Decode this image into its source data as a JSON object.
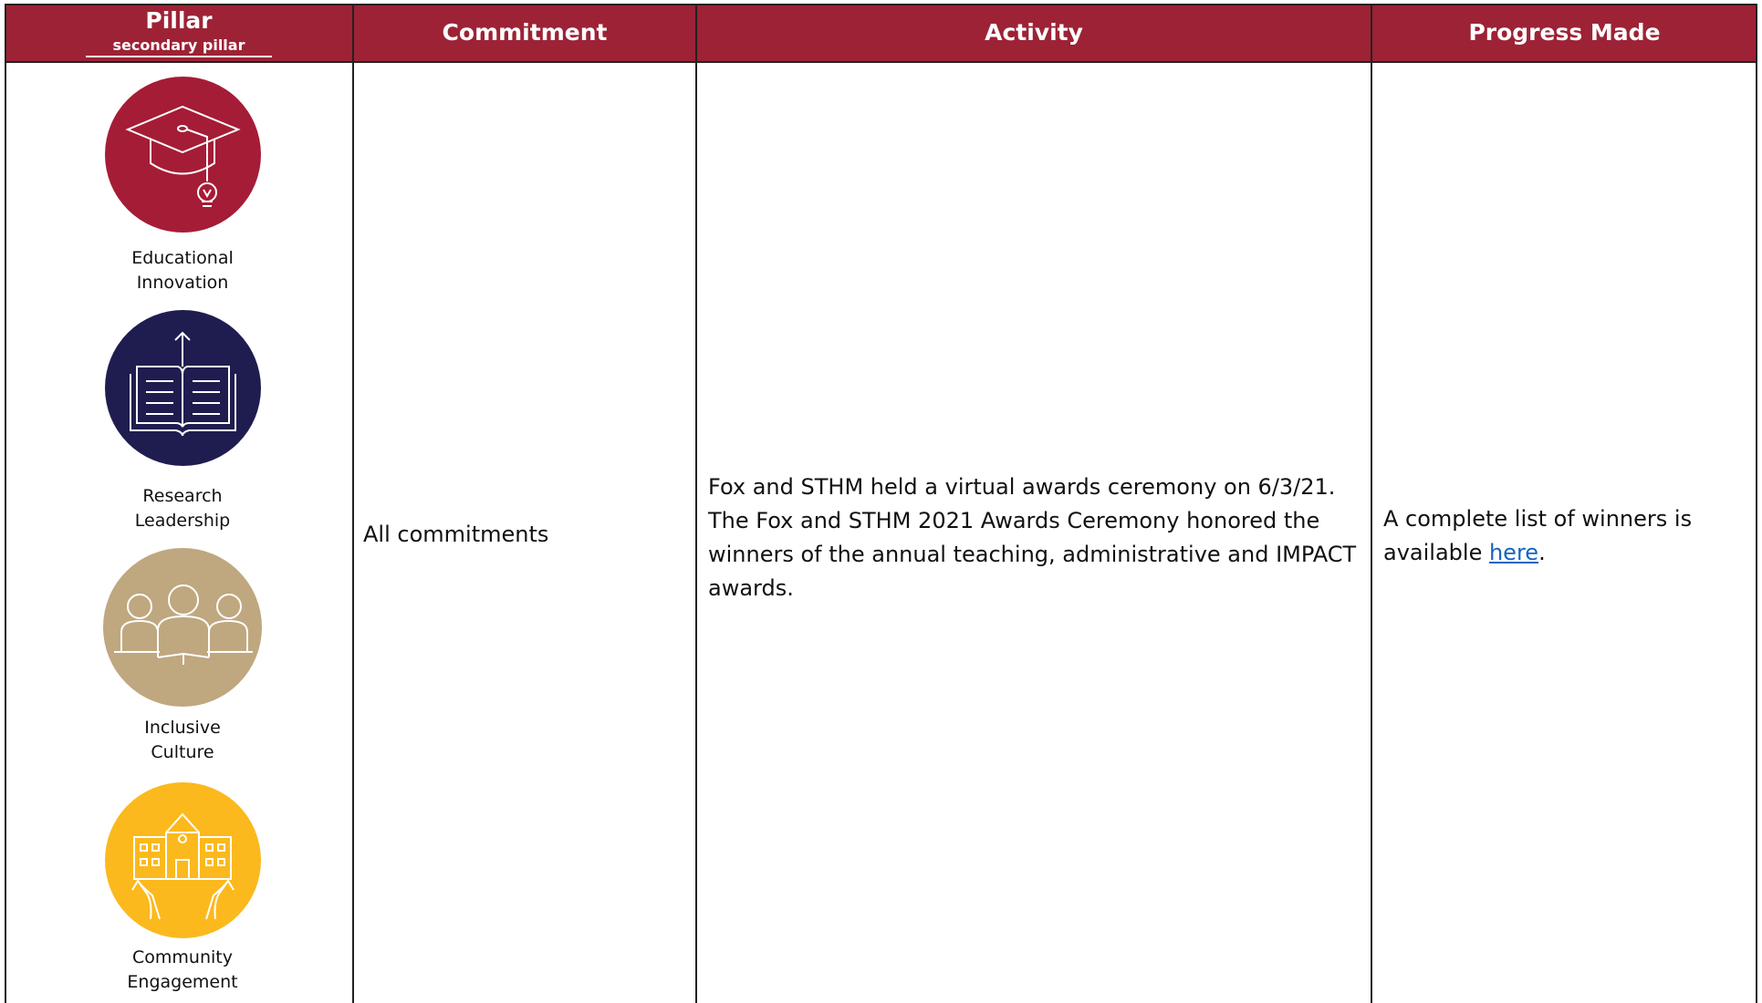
{
  "header": {
    "pillar": "Pillar",
    "pillar_sub": "secondary pillar",
    "commitment": "Commitment",
    "activity": "Activity",
    "progress": "Progress Made"
  },
  "pillars": [
    {
      "label_line1": "Educational",
      "label_line2": "Innovation",
      "icon": "graduation-cap-lightbulb-icon",
      "color": "#a51c36"
    },
    {
      "label_line1": "Research",
      "label_line2": "Leadership",
      "icon": "open-book-arrow-icon",
      "color": "#1f1d4f"
    },
    {
      "label_line1": "Inclusive",
      "label_line2": "Culture",
      "icon": "three-people-icon",
      "color": "#bfa77f"
    },
    {
      "label_line1": "Community",
      "label_line2": "Engagement",
      "icon": "building-hands-icon",
      "color": "#fbb91d"
    }
  ],
  "row": {
    "commitment": "All commitments",
    "activity_lines": [
      "Fox and STHM held a virtual awards ceremony on 6/3/21.",
      "The Fox and STHM 2021 Awards Ceremony honored the",
      "winners of the annual teaching, administrative and IMPACT",
      "awards."
    ],
    "progress_line1": "A complete list of winners is",
    "progress_prefix": "available ",
    "progress_link": "here",
    "progress_suffix": "."
  },
  "colors": {
    "header_bg": "#9d2235",
    "link": "#1565c0"
  }
}
